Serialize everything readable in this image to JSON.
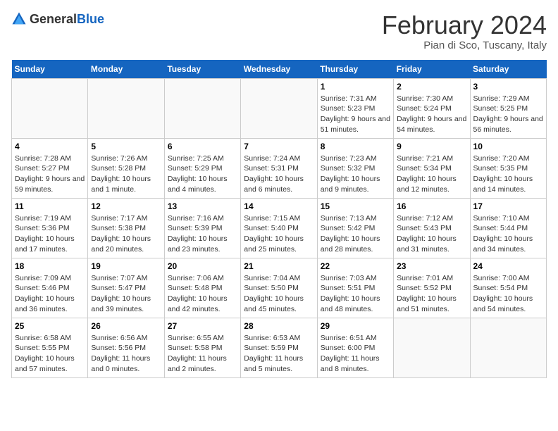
{
  "header": {
    "logo_general": "General",
    "logo_blue": "Blue",
    "title": "February 2024",
    "subtitle": "Pian di Sco, Tuscany, Italy"
  },
  "calendar": {
    "days_of_week": [
      "Sunday",
      "Monday",
      "Tuesday",
      "Wednesday",
      "Thursday",
      "Friday",
      "Saturday"
    ],
    "weeks": [
      [
        {
          "day": "",
          "info": ""
        },
        {
          "day": "",
          "info": ""
        },
        {
          "day": "",
          "info": ""
        },
        {
          "day": "",
          "info": ""
        },
        {
          "day": "1",
          "info": "Sunrise: 7:31 AM\nSunset: 5:23 PM\nDaylight: 9 hours and 51 minutes."
        },
        {
          "day": "2",
          "info": "Sunrise: 7:30 AM\nSunset: 5:24 PM\nDaylight: 9 hours and 54 minutes."
        },
        {
          "day": "3",
          "info": "Sunrise: 7:29 AM\nSunset: 5:25 PM\nDaylight: 9 hours and 56 minutes."
        }
      ],
      [
        {
          "day": "4",
          "info": "Sunrise: 7:28 AM\nSunset: 5:27 PM\nDaylight: 9 hours and 59 minutes."
        },
        {
          "day": "5",
          "info": "Sunrise: 7:26 AM\nSunset: 5:28 PM\nDaylight: 10 hours and 1 minute."
        },
        {
          "day": "6",
          "info": "Sunrise: 7:25 AM\nSunset: 5:29 PM\nDaylight: 10 hours and 4 minutes."
        },
        {
          "day": "7",
          "info": "Sunrise: 7:24 AM\nSunset: 5:31 PM\nDaylight: 10 hours and 6 minutes."
        },
        {
          "day": "8",
          "info": "Sunrise: 7:23 AM\nSunset: 5:32 PM\nDaylight: 10 hours and 9 minutes."
        },
        {
          "day": "9",
          "info": "Sunrise: 7:21 AM\nSunset: 5:34 PM\nDaylight: 10 hours and 12 minutes."
        },
        {
          "day": "10",
          "info": "Sunrise: 7:20 AM\nSunset: 5:35 PM\nDaylight: 10 hours and 14 minutes."
        }
      ],
      [
        {
          "day": "11",
          "info": "Sunrise: 7:19 AM\nSunset: 5:36 PM\nDaylight: 10 hours and 17 minutes."
        },
        {
          "day": "12",
          "info": "Sunrise: 7:17 AM\nSunset: 5:38 PM\nDaylight: 10 hours and 20 minutes."
        },
        {
          "day": "13",
          "info": "Sunrise: 7:16 AM\nSunset: 5:39 PM\nDaylight: 10 hours and 23 minutes."
        },
        {
          "day": "14",
          "info": "Sunrise: 7:15 AM\nSunset: 5:40 PM\nDaylight: 10 hours and 25 minutes."
        },
        {
          "day": "15",
          "info": "Sunrise: 7:13 AM\nSunset: 5:42 PM\nDaylight: 10 hours and 28 minutes."
        },
        {
          "day": "16",
          "info": "Sunrise: 7:12 AM\nSunset: 5:43 PM\nDaylight: 10 hours and 31 minutes."
        },
        {
          "day": "17",
          "info": "Sunrise: 7:10 AM\nSunset: 5:44 PM\nDaylight: 10 hours and 34 minutes."
        }
      ],
      [
        {
          "day": "18",
          "info": "Sunrise: 7:09 AM\nSunset: 5:46 PM\nDaylight: 10 hours and 36 minutes."
        },
        {
          "day": "19",
          "info": "Sunrise: 7:07 AM\nSunset: 5:47 PM\nDaylight: 10 hours and 39 minutes."
        },
        {
          "day": "20",
          "info": "Sunrise: 7:06 AM\nSunset: 5:48 PM\nDaylight: 10 hours and 42 minutes."
        },
        {
          "day": "21",
          "info": "Sunrise: 7:04 AM\nSunset: 5:50 PM\nDaylight: 10 hours and 45 minutes."
        },
        {
          "day": "22",
          "info": "Sunrise: 7:03 AM\nSunset: 5:51 PM\nDaylight: 10 hours and 48 minutes."
        },
        {
          "day": "23",
          "info": "Sunrise: 7:01 AM\nSunset: 5:52 PM\nDaylight: 10 hours and 51 minutes."
        },
        {
          "day": "24",
          "info": "Sunrise: 7:00 AM\nSunset: 5:54 PM\nDaylight: 10 hours and 54 minutes."
        }
      ],
      [
        {
          "day": "25",
          "info": "Sunrise: 6:58 AM\nSunset: 5:55 PM\nDaylight: 10 hours and 57 minutes."
        },
        {
          "day": "26",
          "info": "Sunrise: 6:56 AM\nSunset: 5:56 PM\nDaylight: 11 hours and 0 minutes."
        },
        {
          "day": "27",
          "info": "Sunrise: 6:55 AM\nSunset: 5:58 PM\nDaylight: 11 hours and 2 minutes."
        },
        {
          "day": "28",
          "info": "Sunrise: 6:53 AM\nSunset: 5:59 PM\nDaylight: 11 hours and 5 minutes."
        },
        {
          "day": "29",
          "info": "Sunrise: 6:51 AM\nSunset: 6:00 PM\nDaylight: 11 hours and 8 minutes."
        },
        {
          "day": "",
          "info": ""
        },
        {
          "day": "",
          "info": ""
        }
      ]
    ]
  }
}
